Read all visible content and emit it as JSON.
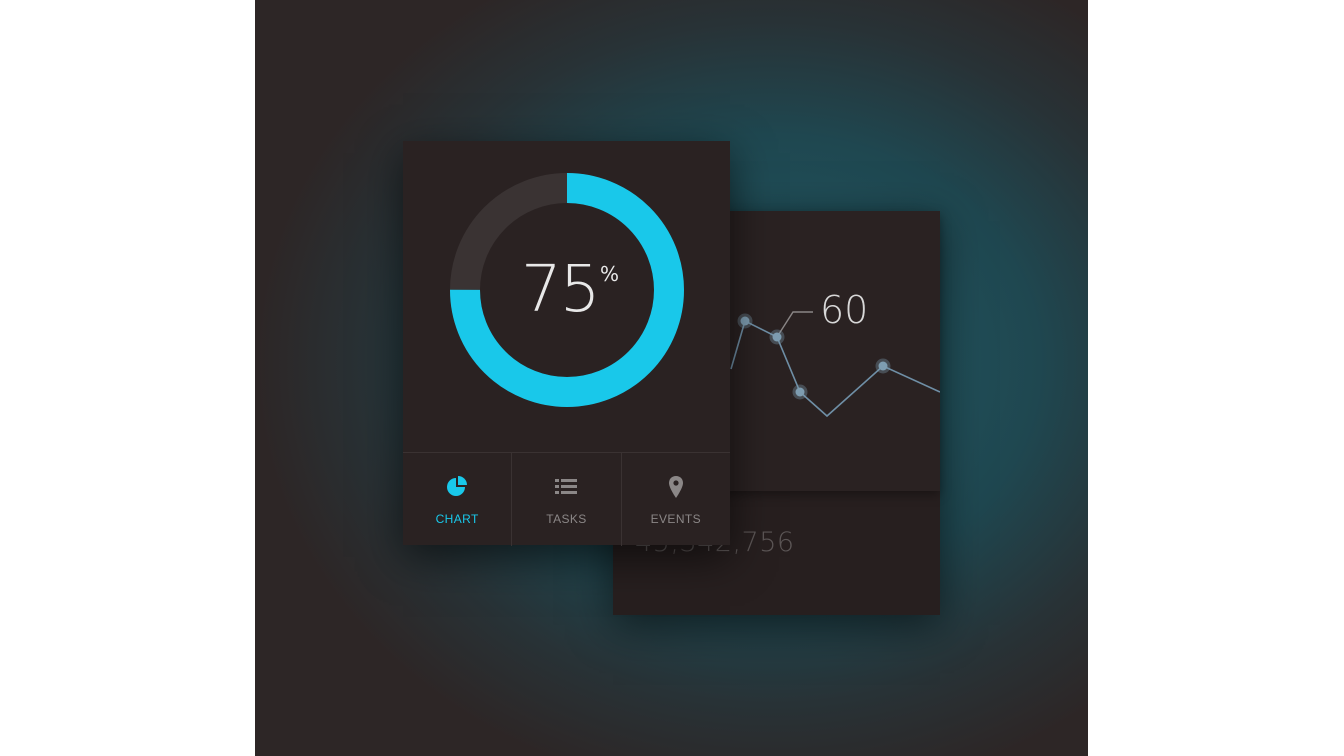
{
  "progress": {
    "value": 75,
    "number_text": "75",
    "unit": "%"
  },
  "colors": {
    "accent": "#19c8ea",
    "ring_track": "#3a3333",
    "card": "#2a2222",
    "line": "#6f8fa6"
  },
  "tabs": [
    {
      "label": "CHART",
      "icon": "pie-chart-icon",
      "active": true
    },
    {
      "label": "TASKS",
      "icon": "list-icon",
      "active": false
    },
    {
      "label": "EVENTS",
      "icon": "map-pin-icon",
      "active": false
    }
  ],
  "secondary_card": {
    "callout_value": "60",
    "total_text": "45,342,756"
  }
}
